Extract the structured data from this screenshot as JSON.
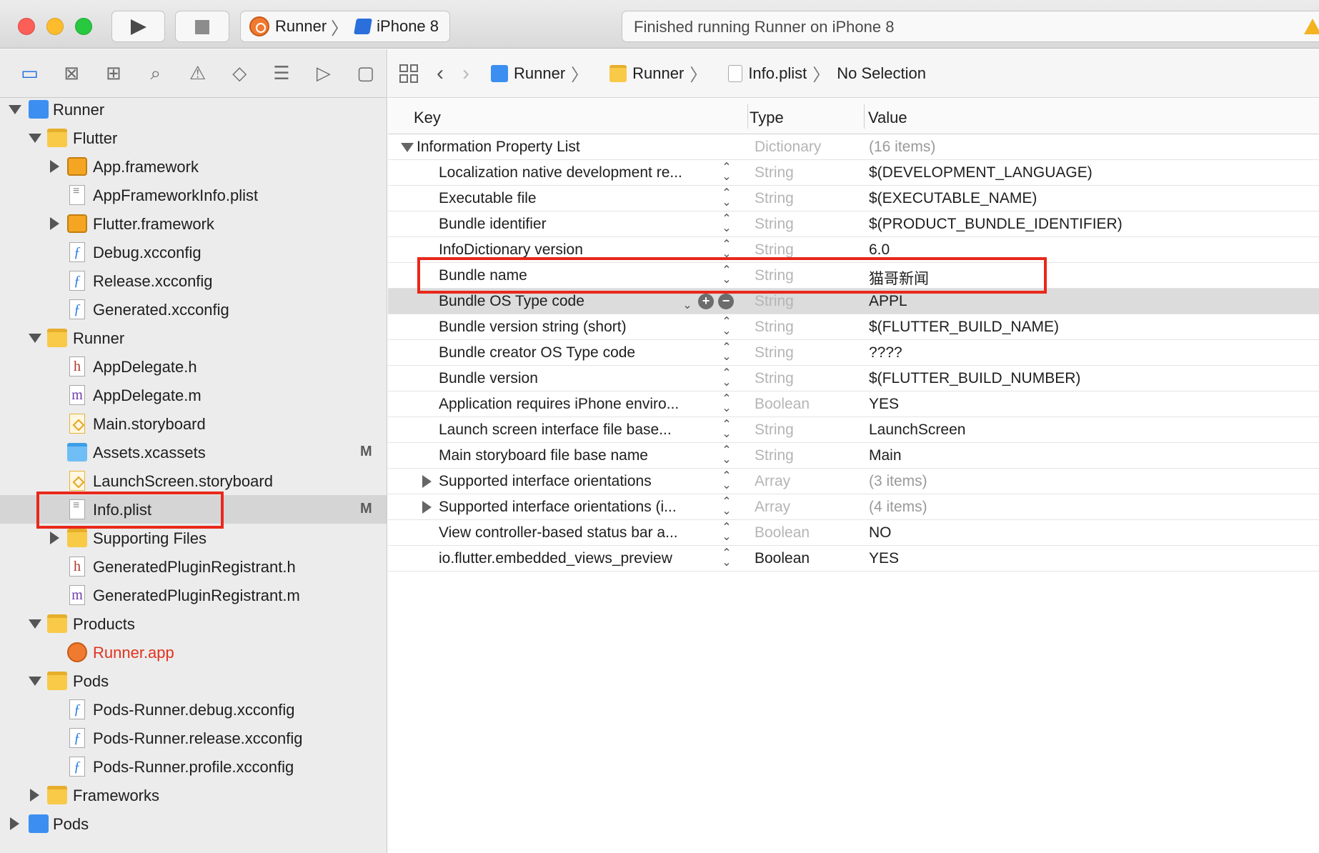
{
  "toolbar": {
    "scheme_target": "Runner",
    "scheme_device": "iPhone 8",
    "status": "Finished running Runner on iPhone 8"
  },
  "navigator": {
    "tabs": [
      "folder-icon",
      "source-control-icon",
      "symbol-icon",
      "search-icon",
      "issue-icon",
      "test-icon",
      "debug-icon",
      "breakpoint-icon",
      "report-icon"
    ],
    "items": [
      {
        "label": "Runner"
      },
      {
        "label": "Flutter"
      },
      {
        "label": "App.framework"
      },
      {
        "label": "AppFrameworkInfo.plist"
      },
      {
        "label": "Flutter.framework"
      },
      {
        "label": "Debug.xcconfig"
      },
      {
        "label": "Release.xcconfig"
      },
      {
        "label": "Generated.xcconfig"
      },
      {
        "label": "Runner"
      },
      {
        "label": "AppDelegate.h"
      },
      {
        "label": "AppDelegate.m"
      },
      {
        "label": "Main.storyboard"
      },
      {
        "label": "Assets.xcassets",
        "badge": "M"
      },
      {
        "label": "LaunchScreen.storyboard"
      },
      {
        "label": "Info.plist",
        "badge": "M"
      },
      {
        "label": "Supporting Files"
      },
      {
        "label": "GeneratedPluginRegistrant.h"
      },
      {
        "label": "GeneratedPluginRegistrant.m"
      },
      {
        "label": "Products"
      },
      {
        "label": "Runner.app"
      },
      {
        "label": "Pods"
      },
      {
        "label": "Pods-Runner.debug.xcconfig"
      },
      {
        "label": "Pods-Runner.release.xcconfig"
      },
      {
        "label": "Pods-Runner.profile.xcconfig"
      },
      {
        "label": "Frameworks"
      },
      {
        "label": "Pods"
      }
    ]
  },
  "jumpbar": {
    "crumbs": [
      "Runner",
      "Runner",
      "Info.plist",
      "No Selection"
    ]
  },
  "plist": {
    "headers": {
      "key": "Key",
      "type": "Type",
      "value": "Value"
    },
    "rows": [
      {
        "key": "Information Property List",
        "type": "Dictionary",
        "value": "(16 items)"
      },
      {
        "key": "Localization native development re...",
        "type": "String",
        "value": "$(DEVELOPMENT_LANGUAGE)"
      },
      {
        "key": "Executable file",
        "type": "String",
        "value": "$(EXECUTABLE_NAME)"
      },
      {
        "key": "Bundle identifier",
        "type": "String",
        "value": "$(PRODUCT_BUNDLE_IDENTIFIER)"
      },
      {
        "key": "InfoDictionary version",
        "type": "String",
        "value": "6.0"
      },
      {
        "key": "Bundle name",
        "type": "String",
        "value": "猫哥新闻"
      },
      {
        "key": "Bundle OS Type code",
        "type": "String",
        "value": "APPL"
      },
      {
        "key": "Bundle version string (short)",
        "type": "String",
        "value": "$(FLUTTER_BUILD_NAME)"
      },
      {
        "key": "Bundle creator OS Type code",
        "type": "String",
        "value": "????"
      },
      {
        "key": "Bundle version",
        "type": "String",
        "value": "$(FLUTTER_BUILD_NUMBER)"
      },
      {
        "key": "Application requires iPhone enviro...",
        "type": "Boolean",
        "value": "YES"
      },
      {
        "key": "Launch screen interface file base...",
        "type": "String",
        "value": "LaunchScreen"
      },
      {
        "key": "Main storyboard file base name",
        "type": "String",
        "value": "Main"
      },
      {
        "key": "Supported interface orientations",
        "type": "Array",
        "value": "(3 items)"
      },
      {
        "key": "Supported interface orientations (i...",
        "type": "Array",
        "value": "(4 items)"
      },
      {
        "key": "View controller-based status bar a...",
        "type": "Boolean",
        "value": "NO"
      },
      {
        "key": "io.flutter.embedded_views_preview",
        "type": "Boolean",
        "value": "YES"
      }
    ]
  },
  "colors": {
    "accent": "#1a6ddf",
    "highlight": "#e8281b",
    "product": "#e0331e"
  }
}
